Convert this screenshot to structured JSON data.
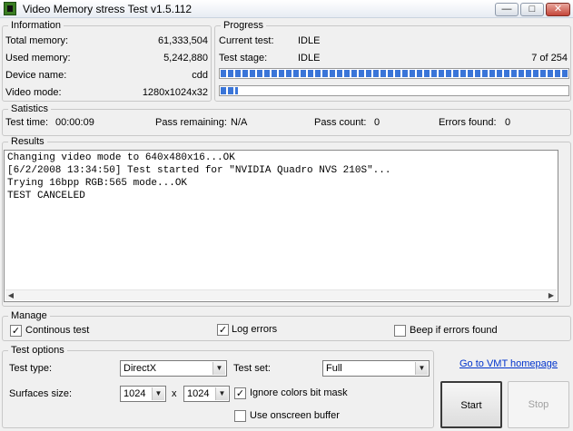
{
  "window": {
    "title": "Video Memory stress Test v1.5.112",
    "min_glyph": "—",
    "max_glyph": "□",
    "close_glyph": "✕"
  },
  "information": {
    "legend": "Information",
    "rows": [
      {
        "label": "Total memory:",
        "value": "61,333,504"
      },
      {
        "label": "Used memory:",
        "value": "5,242,880"
      },
      {
        "label": "Device name:",
        "value": "cdd"
      },
      {
        "label": "Video mode:",
        "value": "1280x1024x32"
      }
    ]
  },
  "progress": {
    "legend": "Progress",
    "current_test_label": "Current test:",
    "current_test_value": "IDLE",
    "test_stage_label": "Test stage:",
    "test_stage_value": "IDLE",
    "stage_count": "7 of 254",
    "stage_bar_fraction": 1.0,
    "sub_bar_fraction": 0.05
  },
  "statistics": {
    "legend": "Satistics",
    "test_time_label": "Test time:",
    "test_time_value": "00:00:09",
    "pass_remaining_label": "Pass remaining:",
    "pass_remaining_value": "N/A",
    "pass_count_label": "Pass count:",
    "pass_count_value": "0",
    "errors_found_label": "Errors found:",
    "errors_found_value": "0"
  },
  "results": {
    "legend": "Results",
    "lines": [
      "Changing video mode to 640x480x16...OK",
      "[6/2/2008 13:34:50] Test started for \"NVIDIA Quadro NVS 210S\"...",
      "Trying 16bpp RGB:565 mode...OK",
      "TEST CANCELED"
    ]
  },
  "manage": {
    "legend": "Manage",
    "continous_test": {
      "label": "Continous test",
      "checked": true
    },
    "log_errors": {
      "label": "Log errors",
      "checked": true
    },
    "beep_errors": {
      "label": "Beep if errors found",
      "checked": false
    }
  },
  "test_options": {
    "legend": "Test options",
    "test_type_label": "Test type:",
    "test_type_value": "DirectX",
    "test_set_label": "Test set:",
    "test_set_value": "Full",
    "surfaces_label": "Surfaces size:",
    "surface_width": "1024",
    "times": "x",
    "surface_height": "1024",
    "ignore_colors": {
      "label": "Ignore colors bit mask",
      "checked": true
    },
    "onscreen_buffer": {
      "label": "Use onscreen buffer",
      "checked": false
    }
  },
  "links": {
    "homepage": "Go to VMT homepage"
  },
  "buttons": {
    "start": "Start",
    "stop": "Stop"
  },
  "glyphs": {
    "check": "✓",
    "dropdown": "▼",
    "arrow_left": "◀",
    "arrow_right": "▶"
  }
}
